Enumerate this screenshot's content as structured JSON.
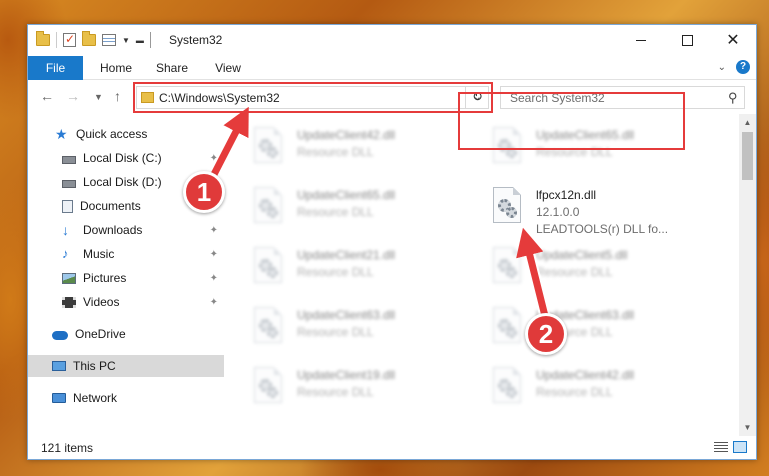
{
  "window": {
    "title": "System32",
    "minimize_label": "",
    "maximize_label": "",
    "close_label": "✕"
  },
  "ribbon": {
    "tabs": [
      {
        "label": "File"
      },
      {
        "label": "Home"
      },
      {
        "label": "Share"
      },
      {
        "label": "View"
      }
    ],
    "help_label": "?"
  },
  "address": {
    "path": "C:\\Windows\\System32",
    "search_placeholder": "Search System32"
  },
  "sidebar": {
    "items": [
      {
        "label": "Quick access",
        "icon": "star-icon"
      },
      {
        "label": "Local Disk (C:)",
        "icon": "disk-icon",
        "pinned": true
      },
      {
        "label": "Local Disk (D:)",
        "icon": "disk-icon"
      },
      {
        "label": "Documents",
        "icon": "documents-icon",
        "pinned": true
      },
      {
        "label": "Downloads",
        "icon": "downloads-icon",
        "pinned": true
      },
      {
        "label": "Music",
        "icon": "music-icon",
        "pinned": true
      },
      {
        "label": "Pictures",
        "icon": "pictures-icon",
        "pinned": true
      },
      {
        "label": "Videos",
        "icon": "videos-icon",
        "pinned": true
      },
      {
        "label": "OneDrive",
        "icon": "cloud-icon"
      },
      {
        "label": "This PC",
        "icon": "computer-icon",
        "selected": true
      },
      {
        "label": "Network",
        "icon": "network-icon"
      }
    ]
  },
  "files": [
    {
      "name": "UpdateClient42.dll",
      "line1": "Resource DLL",
      "line2": ""
    },
    {
      "name": "UpdateClient65.dll",
      "line1": "Resource DLL",
      "line2": ""
    },
    {
      "name": "UpdateClient65.dll",
      "line1": "Resource DLL",
      "line2": ""
    },
    {
      "name": "lfpcx12n.dll",
      "line1": "12.1.0.0",
      "line2": "LEADTOOLS(r) DLL fo..."
    },
    {
      "name": "UpdateClient21.dll",
      "line1": "Resource DLL",
      "line2": ""
    },
    {
      "name": "UpdateClient5.dll",
      "line1": "Resource DLL",
      "line2": ""
    },
    {
      "name": "UpdateClient63.dll",
      "line1": "Resource DLL",
      "line2": ""
    },
    {
      "name": "UpdateClient63.dll",
      "line1": "Resource DLL",
      "line2": ""
    },
    {
      "name": "UpdateClient19.dll",
      "line1": "Resource DLL",
      "line2": ""
    },
    {
      "name": "UpdateClient42.dll",
      "line1": "Resource DLL",
      "line2": ""
    }
  ],
  "status": {
    "item_count": "121 items"
  },
  "annotations": {
    "step1": "1",
    "step2": "2",
    "color": "#e53b3b"
  }
}
